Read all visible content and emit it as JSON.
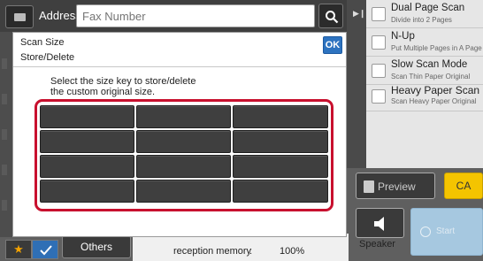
{
  "header": {
    "address_label": "Address",
    "fax_placeholder": "Fax Number",
    "search_icon": "search-icon"
  },
  "options": [
    {
      "title": "Dual Page Scan",
      "subtitle": "Divide into 2 Pages"
    },
    {
      "title": "N-Up",
      "subtitle": "Put Multiple Pages in A Page"
    },
    {
      "title": "Slow Scan Mode",
      "subtitle": "Scan Thin Paper Original"
    },
    {
      "title": "Heavy Paper Scan",
      "subtitle": "Scan Heavy Paper Original"
    }
  ],
  "dialog": {
    "title": "Scan Size",
    "subtitle": "Store/Delete",
    "ok_label": "OK",
    "instruction_line1": "Select the size key to store/delete",
    "instruction_line2": "the custom original size.",
    "size_key_count": 12
  },
  "buttons": {
    "preview_label": "Preview",
    "ca_label": "CA",
    "speaker_label": "Speaker",
    "start_label": "Start",
    "others_label": "Others"
  },
  "status": {
    "memory_label": "reception memory",
    "memory_colon": ":",
    "memory_value": "100%"
  },
  "colors": {
    "accent_blue": "#2d73c0",
    "ca_yellow": "#f4c400",
    "highlight_red": "#c8102e",
    "start_disabled": "#a6c8e0"
  }
}
